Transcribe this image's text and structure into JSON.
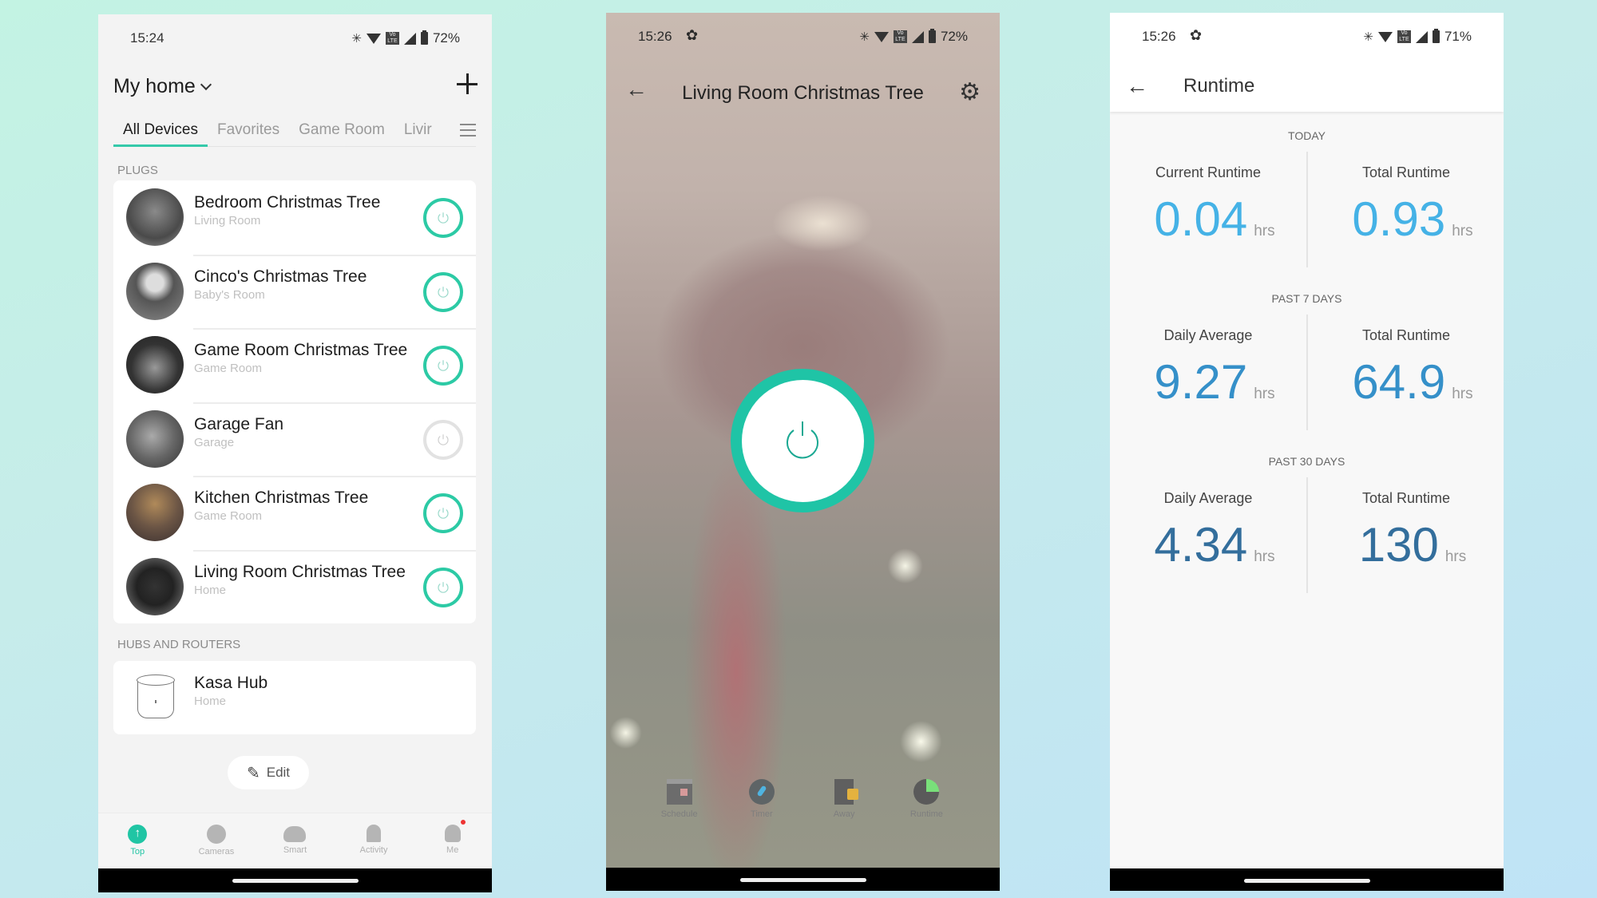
{
  "colors": {
    "accent": "#20c5a4",
    "runtime_today": "#45b2e6",
    "runtime_7days": "#3590c9",
    "runtime_30days": "#336e9c"
  },
  "left_phone": {
    "status": {
      "time": "15:24",
      "battery": "72%"
    },
    "home_title": "My home",
    "tabs": [
      {
        "label": "All Devices",
        "active": true
      },
      {
        "label": "Favorites",
        "active": false
      },
      {
        "label": "Game Room",
        "active": false
      },
      {
        "label": "Livir",
        "active": false
      }
    ],
    "plugs_label": "PLUGS",
    "devices": [
      {
        "name": "Bedroom Christmas Tree",
        "room": "Living Room",
        "power": "on"
      },
      {
        "name": "Cinco's Christmas Tree",
        "room": "Baby's Room",
        "power": "on"
      },
      {
        "name": "Game Room Christmas Tree",
        "room": "Game Room",
        "power": "on"
      },
      {
        "name": "Garage Fan",
        "room": "Garage",
        "power": "off"
      },
      {
        "name": "Kitchen Christmas Tree",
        "room": "Game Room",
        "power": "on"
      },
      {
        "name": "Living Room Christmas Tree",
        "room": "Home",
        "power": "on"
      }
    ],
    "hubs_label": "HUBS AND ROUTERS",
    "hubs": [
      {
        "name": "Kasa Hub",
        "room": "Home"
      }
    ],
    "edit_label": "Edit",
    "bottom_nav": [
      {
        "label": "Top",
        "icon": "top-icon",
        "active": true
      },
      {
        "label": "Cameras",
        "icon": "camera-icon",
        "active": false
      },
      {
        "label": "Smart",
        "icon": "cloud-icon",
        "active": false
      },
      {
        "label": "Activity",
        "icon": "bell-icon",
        "active": false
      },
      {
        "label": "Me",
        "icon": "person-icon",
        "active": false
      }
    ]
  },
  "middle_phone": {
    "status": {
      "time": "15:26",
      "battery": "72%"
    },
    "title": "Living Room Christmas Tree",
    "power_state": "on",
    "features": [
      {
        "label": "Schedule",
        "icon": "schedule-icon"
      },
      {
        "label": "Timer",
        "icon": "timer-icon"
      },
      {
        "label": "Away",
        "icon": "away-icon"
      },
      {
        "label": "Runtime",
        "icon": "runtime-icon"
      }
    ]
  },
  "right_phone": {
    "status": {
      "time": "15:26",
      "battery": "71%"
    },
    "title": "Runtime",
    "sections": [
      {
        "label": "TODAY",
        "left": {
          "label": "Current Runtime",
          "value": "0.04",
          "unit": "hrs"
        },
        "right": {
          "label": "Total Runtime",
          "value": "0.93",
          "unit": "hrs"
        }
      },
      {
        "label": "PAST 7 DAYS",
        "left": {
          "label": "Daily Average",
          "value": "9.27",
          "unit": "hrs"
        },
        "right": {
          "label": "Total Runtime",
          "value": "64.9",
          "unit": "hrs"
        }
      },
      {
        "label": "PAST 30 DAYS",
        "left": {
          "label": "Daily Average",
          "value": "4.34",
          "unit": "hrs"
        },
        "right": {
          "label": "Total Runtime",
          "value": "130",
          "unit": "hrs"
        }
      }
    ]
  }
}
